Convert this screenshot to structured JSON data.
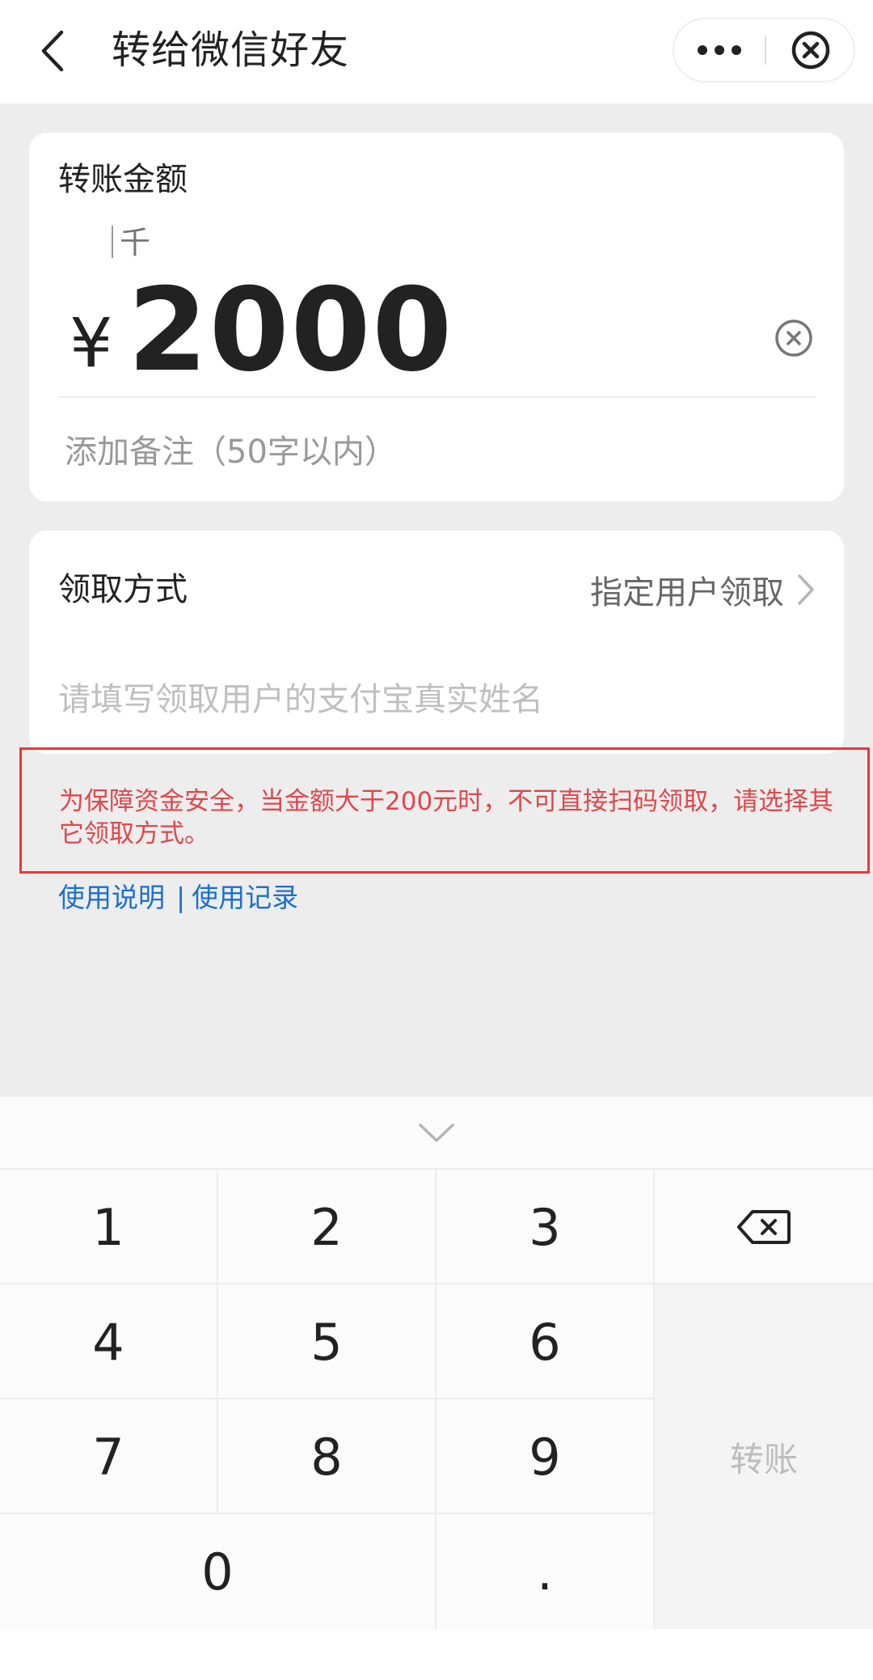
{
  "header": {
    "title": "转给微信好友"
  },
  "amount_card": {
    "label": "转账金额",
    "unit_hint": "千",
    "currency_symbol": "¥",
    "amount": "2000",
    "remark_placeholder": "添加备注（50字以内）"
  },
  "receive_card": {
    "label": "领取方式",
    "method": "指定用户领取",
    "name_placeholder": "请填写领取用户的支付宝真实姓名"
  },
  "warning": {
    "text": "为保障资金安全，当金额大于200元时，不可直接扫码领取，请选择其它领取方式。",
    "color": "#e0474c"
  },
  "links": {
    "instructions": "使用说明",
    "separator": "|",
    "records": "使用记录",
    "color": "#1a6fd0"
  },
  "keyboard": {
    "keys": [
      "1",
      "2",
      "3",
      "4",
      "5",
      "6",
      "7",
      "8",
      "9",
      "0",
      "."
    ],
    "transfer_label": "转账",
    "icons": {
      "collapse": "chevron-down-icon",
      "backspace": "backspace-icon"
    }
  }
}
